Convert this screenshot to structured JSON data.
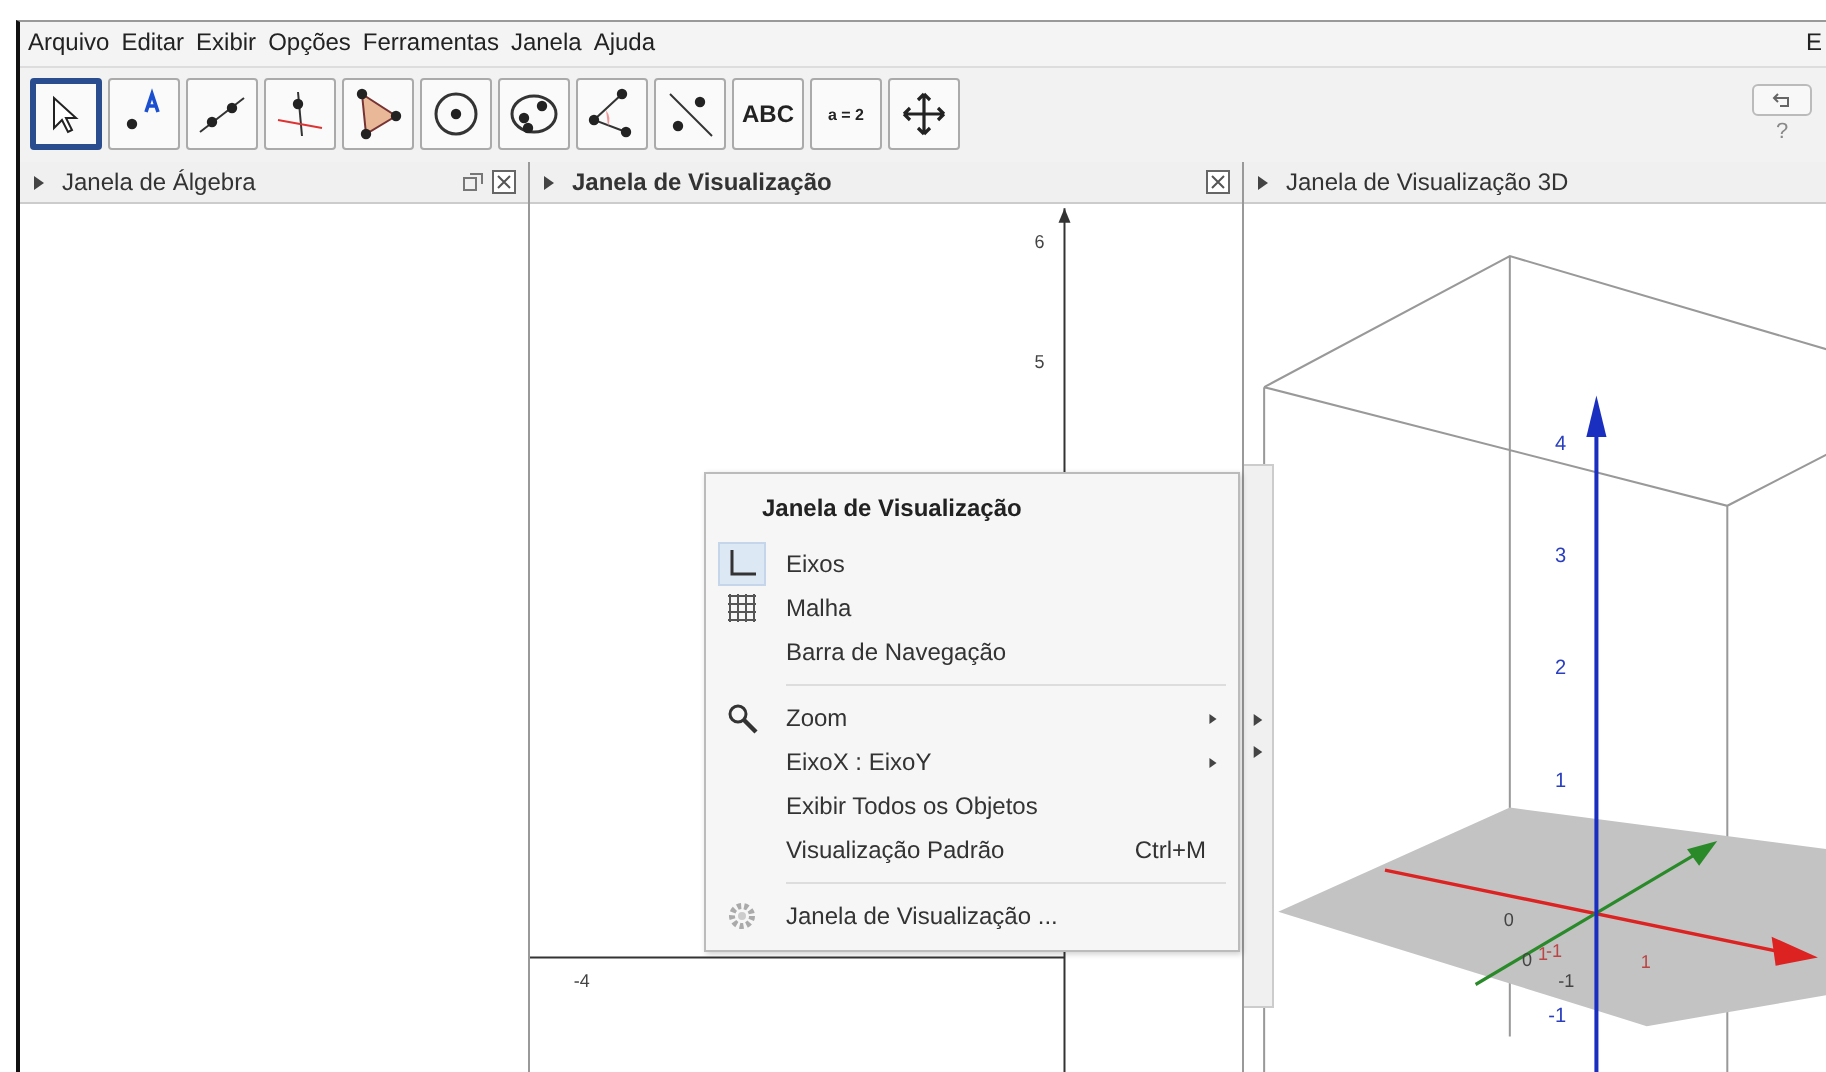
{
  "menu_bar": [
    "Arquivo",
    "Editar",
    "Exibir",
    "Opções",
    "Ferramentas",
    "Janela",
    "Ajuda",
    "E"
  ],
  "toolbar": [
    {
      "kind": "move",
      "selected": true
    },
    {
      "kind": "point",
      "selected": false
    },
    {
      "kind": "line",
      "selected": false
    },
    {
      "kind": "perpendicular",
      "selected": false
    },
    {
      "kind": "polygon",
      "selected": false
    },
    {
      "kind": "circle",
      "selected": false
    },
    {
      "kind": "conic",
      "selected": false
    },
    {
      "kind": "angle",
      "selected": false
    },
    {
      "kind": "reflect",
      "selected": false
    },
    {
      "kind": "text",
      "label": "ABC",
      "selected": false
    },
    {
      "kind": "slider",
      "label": "a = 2",
      "selected": false
    },
    {
      "kind": "pan",
      "selected": false
    }
  ],
  "help": "?",
  "panels": [
    {
      "kind": "algebra",
      "title": "Janela de Álgebra"
    },
    {
      "kind": "graphics",
      "title": "Janela de Visualização"
    },
    {
      "kind": "graphics3d",
      "title": "Janela de Visualização 3D"
    }
  ],
  "graphics_2d": {
    "y_ticks": [
      "6",
      "5"
    ],
    "x_ticks": [
      "-4"
    ]
  },
  "graphics_3d": {
    "z_ticks": [
      "4",
      "3",
      "2",
      "1",
      "-1"
    ],
    "plane_labels": [
      "0",
      "1",
      "-1",
      "-1",
      "0",
      "1"
    ]
  },
  "context_menu": {
    "title": "Janela de Visualização",
    "items": [
      {
        "kind": "axes",
        "label": "Eixos",
        "checked": true
      },
      {
        "kind": "grid",
        "label": "Malha",
        "checked": false
      },
      {
        "kind": "plain",
        "label": "Barra de Navegação"
      },
      {
        "kind": "separator"
      },
      {
        "kind": "zoom",
        "label": "Zoom",
        "submenu": true
      },
      {
        "kind": "plain",
        "label": "EixoX : EixoY",
        "submenu": true
      },
      {
        "kind": "plain",
        "label": "Exibir Todos os Objetos"
      },
      {
        "kind": "plain",
        "label": "Visualização Padrão",
        "shortcut": "Ctrl+M"
      },
      {
        "kind": "separator"
      },
      {
        "kind": "settings",
        "label": "Janela de Visualização ..."
      }
    ]
  }
}
